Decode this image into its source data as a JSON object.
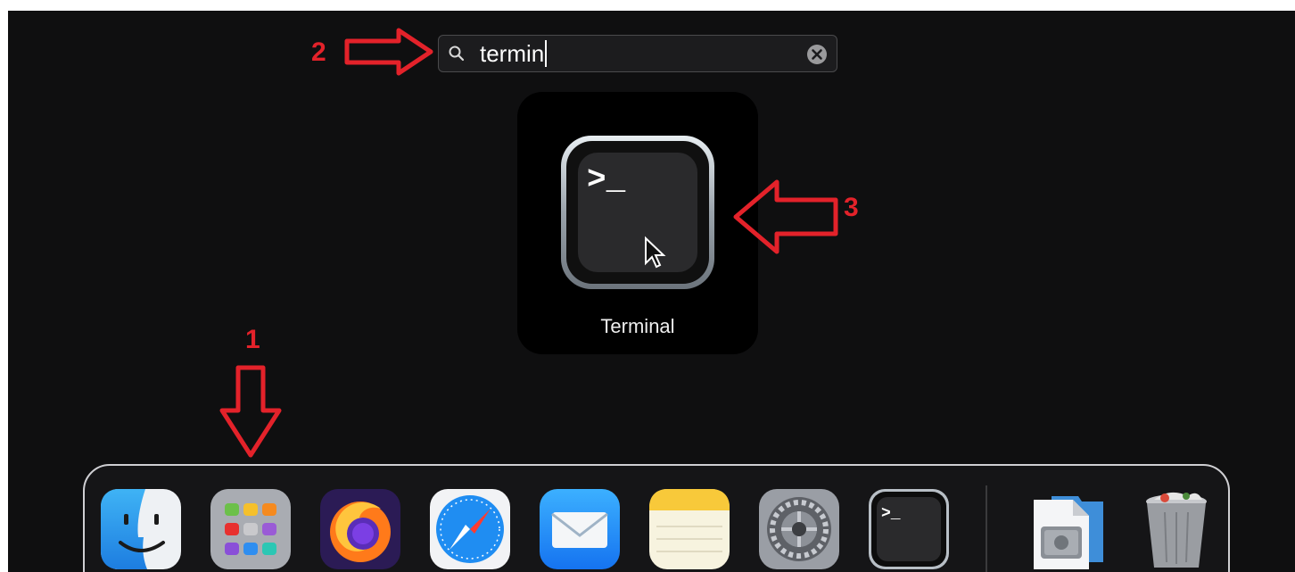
{
  "search": {
    "query": "termin",
    "icon": "search-icon",
    "clear_icon": "clear-icon"
  },
  "result": {
    "label": "Terminal",
    "prompt_glyph": ">_",
    "icon": "terminal-icon"
  },
  "annotations": {
    "step1": "1",
    "step2": "2",
    "step3": "3",
    "color": "#e3222a"
  },
  "dock": {
    "items": [
      {
        "name": "finder",
        "icon": "finder-icon"
      },
      {
        "name": "launchpad",
        "icon": "launchpad-icon"
      },
      {
        "name": "firefox",
        "icon": "firefox-icon"
      },
      {
        "name": "safari",
        "icon": "safari-icon"
      },
      {
        "name": "mail",
        "icon": "mail-icon"
      },
      {
        "name": "notes",
        "icon": "notes-icon"
      },
      {
        "name": "system-preferences",
        "icon": "gear-icon"
      },
      {
        "name": "terminal",
        "icon": "terminal-icon",
        "glyph": ">_"
      },
      {
        "name": "applications-folder",
        "icon": "folder-icon"
      },
      {
        "name": "trash",
        "icon": "trash-icon"
      }
    ]
  }
}
